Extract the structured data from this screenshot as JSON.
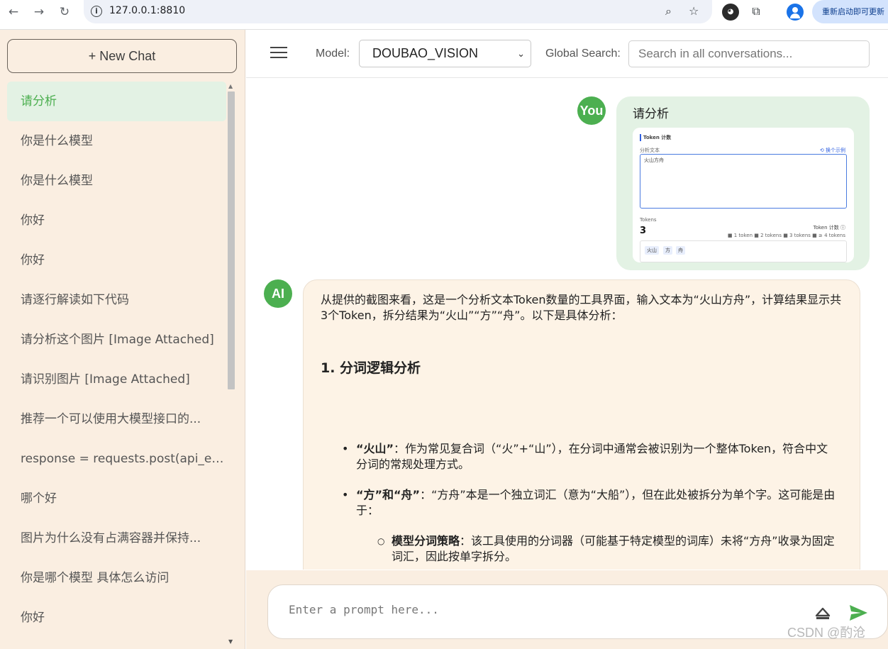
{
  "browser": {
    "url": "127.0.0.1:8810",
    "update_label": "重新启动即可更新"
  },
  "sidebar": {
    "new_chat_label": "+ New Chat",
    "items": [
      {
        "label": "请分析",
        "active": true
      },
      {
        "label": "你是什么模型"
      },
      {
        "label": "你是什么模型"
      },
      {
        "label": "你好"
      },
      {
        "label": "你好"
      },
      {
        "label": "请逐行解读如下代码"
      },
      {
        "label": "请分析这个图片 [Image Attached]"
      },
      {
        "label": "请识别图片 [Image Attached]"
      },
      {
        "label": "推荐一个可以使用大模型接口的..."
      },
      {
        "label": "response = requests.post(api_en..."
      },
      {
        "label": "哪个好"
      },
      {
        "label": "图片为什么没有占满容器并保持..."
      },
      {
        "label": "你是哪个模型 具体怎么访问"
      },
      {
        "label": "你好"
      }
    ]
  },
  "header": {
    "model_label": "Model:",
    "model_value": "DOUBAO_VISION",
    "search_label": "Global Search:",
    "search_placeholder": "Search in all conversations..."
  },
  "conversation": {
    "user_avatar": "You",
    "user_message": "请分析",
    "thumbnail": {
      "title": "Token 计数",
      "field_label": "分析文本",
      "example_link": "⟲ 换个示例",
      "input_text": "火山方舟",
      "tokens_label": "Tokens",
      "count": "3",
      "token_count_label": "Token 计数 ⓘ",
      "legend": "■ 1 token  ■ 2 tokens  ■ 3 tokens  ■ ≥ 4 tokens",
      "chips": [
        "火山",
        "方",
        "舟"
      ]
    },
    "ai_avatar": "AI",
    "ai_intro": "从提供的截图来看，这是一个分析文本Token数量的工具界面，输入文本为“火山方舟”，计算结果显示共3个Token，拆分结果为“火山”“方”“舟”。以下是具体分析：",
    "ai_heading": "1. 分词逻辑分析",
    "bullet1_bold": "“火山”",
    "bullet1_text": "：作为常见复合词（“火”+“山”），在分词中通常会被识别为一个整体Token，符合中文分词的常规处理方式。",
    "bullet2_bold": "“方”和“舟”",
    "bullet2_text": "：“方舟”本是一个独立词汇（意为“大船”），但在此处被拆分为单个字。这可能是由于：",
    "sub1_bold": "模型分词策略",
    "sub1_text": "：该工具使用的分词器（可能基于特定模型的词库）未将“方舟”收录为固定词汇，因此按单字拆分。"
  },
  "input": {
    "placeholder": "Enter a prompt here..."
  },
  "watermark": "CSDN @酌沧"
}
